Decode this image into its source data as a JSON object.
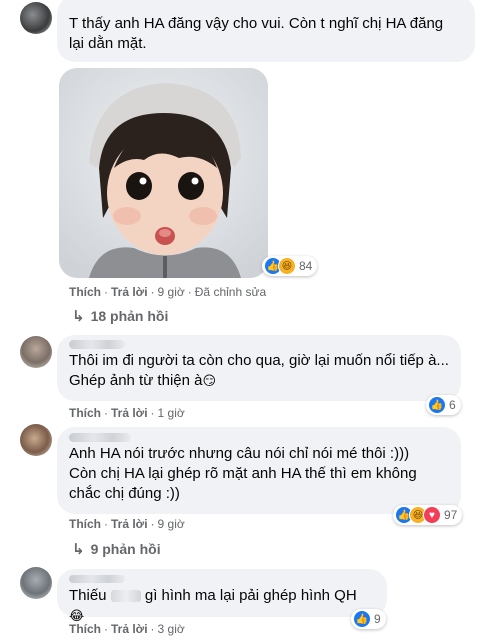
{
  "comments": [
    {
      "text_lines": [
        "T thấy anh HA đăng vậy cho vui. Còn t nghĩ chị HA đăng",
        "lại dằn mặt."
      ],
      "actions": {
        "like": "Thích",
        "reply": "Trả lời",
        "time": "9 giờ",
        "edited": "Đã chỉnh sửa"
      },
      "reactions": {
        "icons": [
          "like-icon",
          "haha-icon"
        ],
        "count": "84"
      },
      "replies_link": "18 phản hồi"
    },
    {
      "text_lines": [
        "Thôi im đi người ta còn cho qua, giờ lại muốn nổi tiếp à...",
        "Ghép ảnh từ thiện à"
      ],
      "emoji": "😏",
      "actions": {
        "like": "Thích",
        "reply": "Trả lời",
        "time": "1 giờ"
      },
      "reactions": {
        "icons": [
          "like-icon"
        ],
        "count": "6"
      }
    },
    {
      "text_lines": [
        "Anh HA nói trước nhưng câu nói chỉ nói mé thôi :)))",
        "Còn chị HA lại ghép rõ mặt anh HA thế thì em không",
        "chắc chị đúng :))"
      ],
      "actions": {
        "like": "Thích",
        "reply": "Trả lời",
        "time": "9 giờ"
      },
      "reactions": {
        "icons": [
          "like-icon",
          "haha-icon",
          "love-icon"
        ],
        "count": "97"
      },
      "replies_link": "9 phản hồi"
    },
    {
      "text_prefix": "Thiếu",
      "text_suffix": "gì hình ma lại pải ghép hình QH",
      "emoji": "😂",
      "actions": {
        "like": "Thích",
        "reply": "Trả lời",
        "time": "3 giờ"
      },
      "reactions": {
        "icons": [
          "like-icon"
        ],
        "count": "9"
      }
    }
  ],
  "colors": {
    "bubble": "#f0f2f5",
    "meta": "#65676b",
    "like_blue": "#1877f2",
    "love_red": "#f33e58",
    "haha_yellow": "#f7b125"
  }
}
